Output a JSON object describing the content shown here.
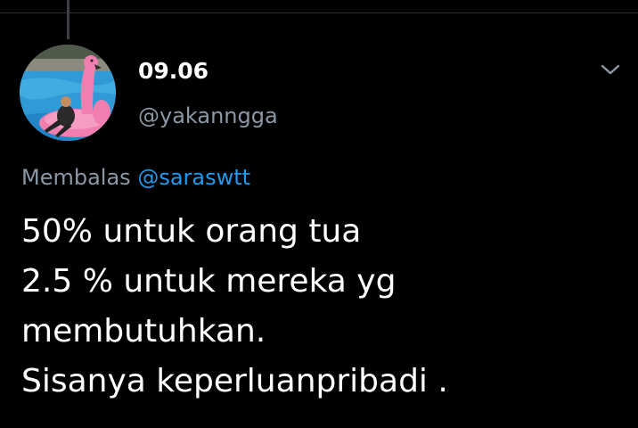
{
  "tweet": {
    "display_name": "09.06",
    "handle": "@yakanngga",
    "reply_prefix": "Membalas",
    "reply_mention": "@saraswtt",
    "text_lines": [
      "50% untuk orang tua",
      "2.5 % untuk mereka yg",
      "membutuhkan.",
      "Sisanya keperluanpribadi ."
    ]
  },
  "icons": {
    "more": "chevron-down-icon",
    "avatar": "avatar-photo-pink-flamingo-float"
  },
  "colors": {
    "background": "#000000",
    "primary_text": "#ffffff",
    "secondary_text": "#8b98a5",
    "mention": "#1d9bf0",
    "divider": "#2f3336"
  }
}
